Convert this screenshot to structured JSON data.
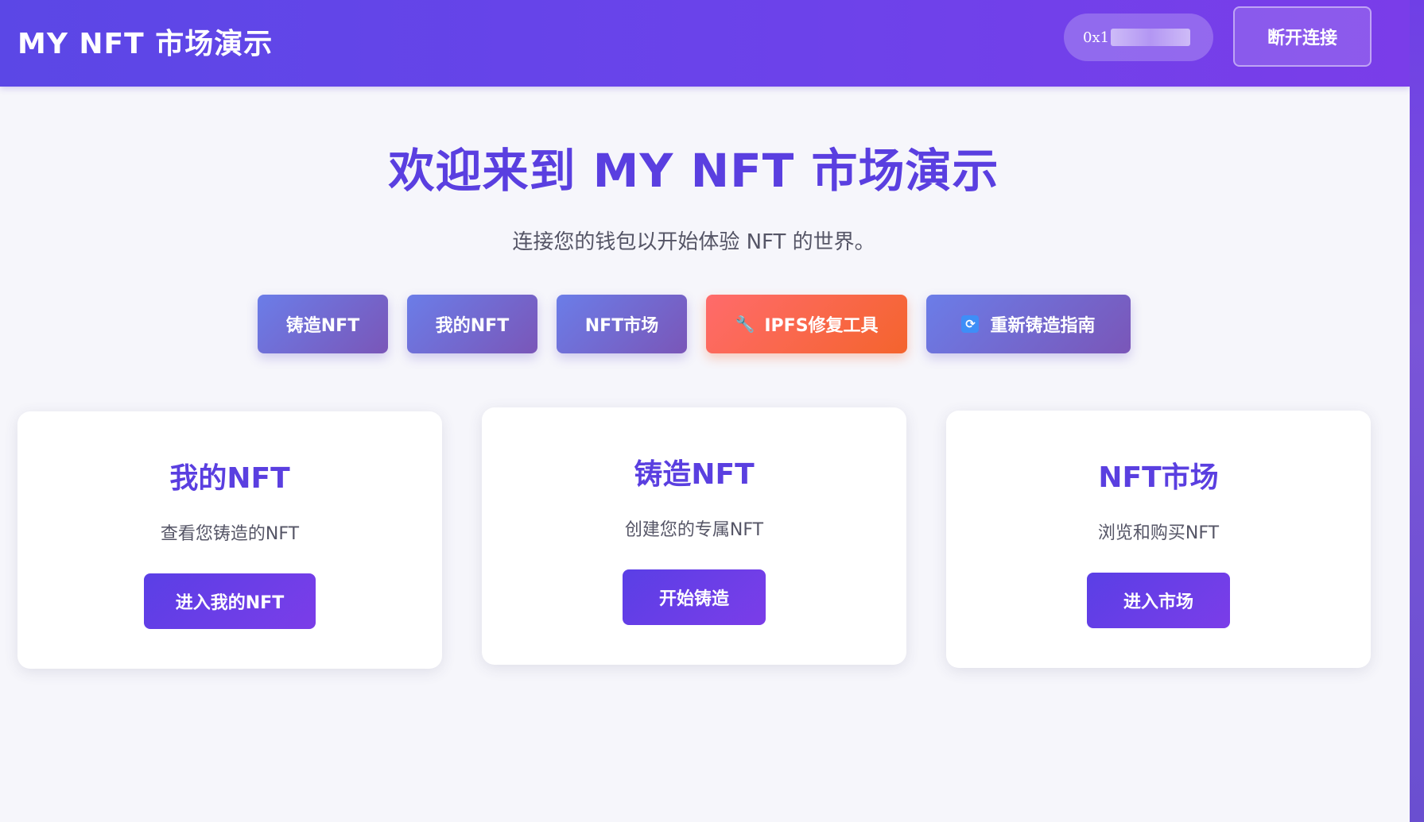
{
  "header": {
    "brand": "MY NFT 市场演示",
    "wallet_address_prefix": "0x1",
    "disconnect_label": "断开连接"
  },
  "hero": {
    "title": "欢迎来到 MY NFT 市场演示",
    "subtitle": "连接您的钱包以开始体验 NFT 的世界。"
  },
  "actions": [
    {
      "label": "铸造NFT"
    },
    {
      "label": "我的NFT"
    },
    {
      "label": "NFT市场"
    },
    {
      "label": "IPFS修复工具",
      "icon": "wrench-icon",
      "glyph": "🔧"
    },
    {
      "label": "重新铸造指南",
      "icon": "refresh-icon",
      "glyph": "🔄"
    }
  ],
  "cards": [
    {
      "title": "我的NFT",
      "description": "查看您铸造的NFT",
      "button": "进入我的NFT"
    },
    {
      "title": "铸造NFT",
      "description": "创建您的专属NFT",
      "button": "开始铸造"
    },
    {
      "title": "NFT市场",
      "description": "浏览和购买NFT",
      "button": "进入市场"
    }
  ],
  "colors": {
    "primary": "#5a3fe0",
    "header_start": "#5b47e6",
    "header_end": "#7a3de9",
    "accent_orange": "#f4642d",
    "background": "#f6f6fb"
  }
}
